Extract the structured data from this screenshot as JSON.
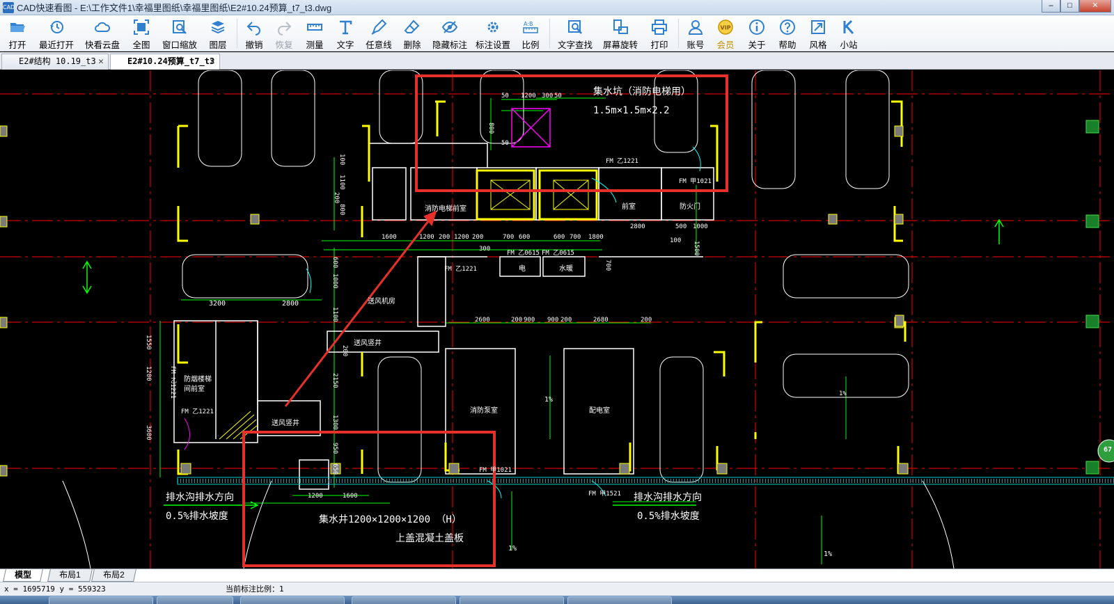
{
  "window": {
    "title": "CAD快速看图 - E:\\工作文件1\\幸福里图纸\\幸福里图纸\\E2#10.24预算_t7_t3.dwg",
    "app_icon_text": "CAD",
    "controls": {
      "minimize": "–",
      "maximize": "□",
      "close": "✕"
    }
  },
  "toolbar": {
    "items": [
      {
        "label": "打开",
        "icon": "folder-open-icon"
      },
      {
        "label": "最近打开",
        "icon": "history-icon"
      },
      {
        "label": "快看云盘",
        "icon": "cloud-icon"
      },
      {
        "label": "全图",
        "icon": "fit-all-icon"
      },
      {
        "label": "窗口缩放",
        "icon": "window-zoom-icon"
      },
      {
        "label": "图层",
        "icon": "layers-icon"
      },
      {
        "label": "撤销",
        "icon": "undo-icon"
      },
      {
        "label": "恢复",
        "icon": "redo-icon",
        "disabled": true
      },
      {
        "label": "测量",
        "icon": "measure-icon"
      },
      {
        "label": "文字",
        "icon": "text-icon"
      },
      {
        "label": "任意线",
        "icon": "pen-icon"
      },
      {
        "label": "删除",
        "icon": "eraser-icon"
      },
      {
        "label": "隐藏标注",
        "icon": "eye-hide-icon"
      },
      {
        "label": "标注设置",
        "icon": "annotation-settings-icon"
      },
      {
        "label": "比例",
        "icon": "scale-icon"
      },
      {
        "label": "文字查找",
        "icon": "text-search-icon"
      },
      {
        "label": "屏幕旋转",
        "icon": "screen-rotate-icon"
      },
      {
        "label": "打印",
        "icon": "printer-icon"
      },
      {
        "label": "账号",
        "icon": "user-icon"
      },
      {
        "label": "会员",
        "icon": "vip-icon"
      },
      {
        "label": "关于",
        "icon": "info-icon"
      },
      {
        "label": "帮助",
        "icon": "help-icon"
      },
      {
        "label": "风格",
        "icon": "style-icon"
      },
      {
        "label": "小站",
        "icon": "k-station-icon"
      }
    ]
  },
  "tabs": [
    {
      "label": "E2#结构 10.19_t3",
      "active": false
    },
    {
      "label": "E2#10.24预算_t7_t3",
      "active": true
    }
  ],
  "drawing": {
    "top_box": {
      "title": "集水坑（消防电梯用）",
      "size": "1.5m×1.5m×2.2"
    },
    "bottom_box": {
      "well_label": "集水井",
      "well_size": "1200×1200×1200 （H）",
      "cover_note": "上盖混凝土盖板"
    },
    "room_labels": {
      "fire_elevator_hall": "消防电梯前室",
      "front_room": "前室",
      "fire_room": "防火门",
      "electric": "电",
      "water": "水暖",
      "blower_room": "送风机房",
      "air_shaft_top": "送风竖井",
      "air_shaft_bottom": "送风竖井",
      "stair_room": "防烟楼梯间前室",
      "pump_room": "消防泵室",
      "power_room": "配电室"
    },
    "notes": {
      "drain_left": "排水沟排水方向",
      "slope_left": "0.5%排水坡度",
      "drain_right": "排水沟排水方向",
      "slope_right": "0.5%排水坡度",
      "percent_a": "1%",
      "percent_b": "1%",
      "percent_c": "1%",
      "percent_d": "1%"
    },
    "door_labels": [
      "FM 乙1221",
      "FM 甲1021",
      "FM 乙1221",
      "FM 乙0615",
      "FM 乙0615",
      "FM 乙1221",
      "FM 乙1221",
      "FM 甲1021",
      "FM 甲1521"
    ],
    "dims": {
      "d_50a": "50",
      "d_1200": "1200",
      "d_300": "300",
      "d_50b": "50",
      "d_800": "800",
      "d_50c": "50",
      "row2": [
        "1600",
        "1200",
        "200",
        "1200",
        "200",
        "300",
        "700",
        "600",
        "600",
        "700",
        "1800"
      ],
      "d_2800": "2800",
      "d_500": "500",
      "d_1000": "1000",
      "d_100": "100",
      "d_1500": "1500",
      "d_700": "700",
      "d_3200": "3200",
      "d_2800b": "2800",
      "row3": [
        "2600",
        "200",
        "900",
        "900",
        "200",
        "2680",
        "200"
      ],
      "d_1200b": "1200",
      "d_1600b": "1600",
      "vert_left": [
        "1550",
        "1200",
        "3600"
      ],
      "vert_mid": [
        "100",
        "1100",
        "200",
        "800",
        "600",
        "1000",
        "1100",
        "200",
        "2150",
        "1300",
        "950",
        "650"
      ]
    },
    "badge": "67"
  },
  "layout_tabs": [
    {
      "label": "模型",
      "active": true
    },
    {
      "label": "布局1",
      "active": false
    },
    {
      "label": "布局2",
      "active": false
    }
  ],
  "status": {
    "coords": "x = 1695719  y = 559323",
    "scale": "当前标注比例：1"
  },
  "colors": {
    "highlight_box": "#e8302a",
    "dimension": "#00ff00",
    "axis": "#ff0000",
    "column": "#ffff00",
    "wall": "#ffffff",
    "drain": "#00ffff"
  }
}
